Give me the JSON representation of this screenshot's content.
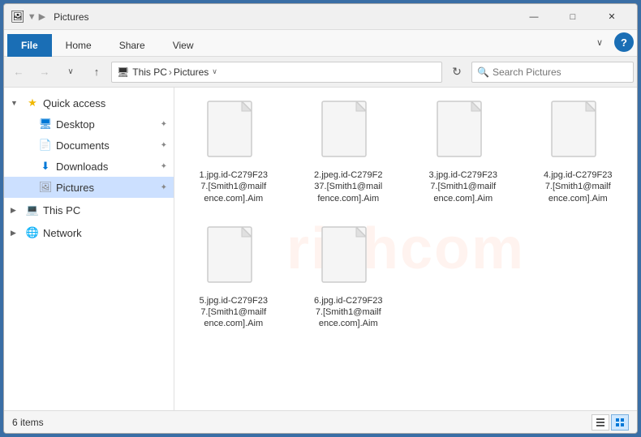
{
  "window": {
    "title": "Pictures",
    "controls": {
      "minimize": "—",
      "maximize": "□",
      "close": "✕"
    }
  },
  "ribbon": {
    "tabs": [
      {
        "label": "File",
        "active": true,
        "style": "blue"
      },
      {
        "label": "Home",
        "active": false
      },
      {
        "label": "Share",
        "active": false
      },
      {
        "label": "View",
        "active": false
      }
    ]
  },
  "addressbar": {
    "back": "←",
    "forward": "→",
    "dropdown": "∨",
    "up": "↑",
    "path_parts": [
      "This PC",
      "Pictures"
    ],
    "refresh": "↻",
    "search_placeholder": "Search Pictures"
  },
  "sidebar": {
    "sections": [
      {
        "items": [
          {
            "label": "Quick access",
            "level": 0,
            "chevron": "▼",
            "icon": "★",
            "iconColor": "#f0b800",
            "active": false
          },
          {
            "label": "Desktop",
            "level": 1,
            "chevron": "",
            "icon": "🖥",
            "iconColor": "#0078d7",
            "pin": "✦",
            "active": false
          },
          {
            "label": "Documents",
            "level": 1,
            "chevron": "",
            "icon": "📄",
            "iconColor": "#888",
            "pin": "✦",
            "active": false
          },
          {
            "label": "Downloads",
            "level": 1,
            "chevron": "",
            "icon": "⬇",
            "iconColor": "#0078d7",
            "pin": "✦",
            "active": false
          },
          {
            "label": "Pictures",
            "level": 1,
            "chevron": "",
            "icon": "🖼",
            "iconColor": "#888",
            "pin": "✦",
            "active": true
          }
        ]
      },
      {
        "items": [
          {
            "label": "This PC",
            "level": 0,
            "chevron": "▶",
            "icon": "💻",
            "iconColor": "#555",
            "active": false
          }
        ]
      },
      {
        "items": [
          {
            "label": "Network",
            "level": 0,
            "chevron": "▶",
            "icon": "🌐",
            "iconColor": "#0078d7",
            "active": false
          }
        ]
      }
    ]
  },
  "files": [
    {
      "name": "1.jpg.id-C279F23\n7.[Smith1@mailf\nence.com].Aim"
    },
    {
      "name": "2.jpeg.id-C279F2\n37.[Smith1@mail\nfence.com].Aim"
    },
    {
      "name": "3.jpg.id-C279F23\n7.[Smith1@mailf\nence.com].Aim"
    },
    {
      "name": "4.jpg.id-C279F23\n7.[Smith1@mailf\nence.com].Aim"
    },
    {
      "name": "5.jpg.id-C279F23\n7.[Smith1@mailf\nence.com].Aim"
    },
    {
      "name": "6.jpg.id-C279F23\n7.[Smith1@mailf\nence.com].Aim"
    }
  ],
  "statusbar": {
    "count": "6 items",
    "views": [
      "list",
      "tiles"
    ]
  }
}
